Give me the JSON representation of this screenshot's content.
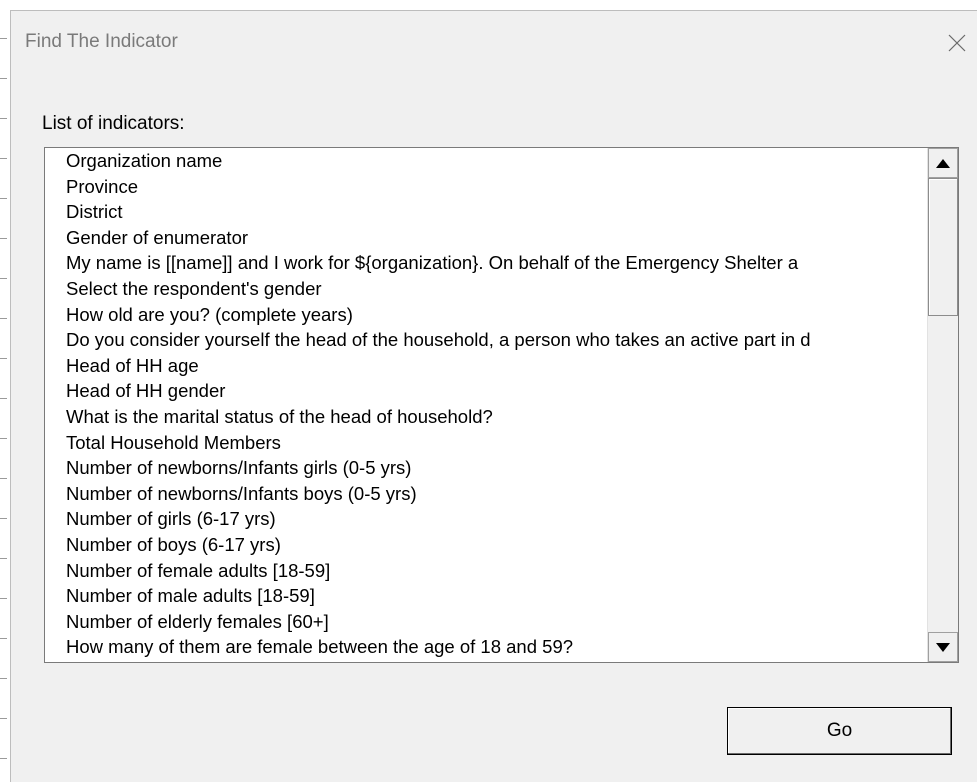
{
  "window": {
    "title": "Find The Indicator",
    "close_icon": "close-icon"
  },
  "list": {
    "label": "List of indicators:",
    "items": [
      "Organization name",
      "Province",
      "District",
      "Gender of enumerator",
      "My name is [[name]] and I work for ${organization}. On behalf of the Emergency Shelter a",
      "Select the respondent's gender",
      "How old are you? (complete years)",
      "Do you consider yourself the head of the household, a person who takes an active part in d",
      "Head of HH age",
      "Head of HH gender",
      "What is the marital status of the head of household?",
      "Total Household Members",
      "Number of newborns/Infants girls (0-5 yrs)",
      "Number of newborns/Infants boys (0-5 yrs)",
      "Number of girls (6-17 yrs)",
      "Number of boys (6-17 yrs)",
      "Number of female adults [18-59]",
      "Number of male adults [18-59]",
      "Number of elderly females [60+]",
      "How many of them are female between the age of 18 and 59?"
    ],
    "scroll_up_icon": "scroll-up-arrow-icon",
    "scroll_down_icon": "scroll-down-arrow-icon"
  },
  "actions": {
    "go_label": "Go"
  },
  "colors": {
    "dialog_bg": "#f0f0f0",
    "list_bg": "#ffffff",
    "title_text": "#7a7a7a"
  }
}
